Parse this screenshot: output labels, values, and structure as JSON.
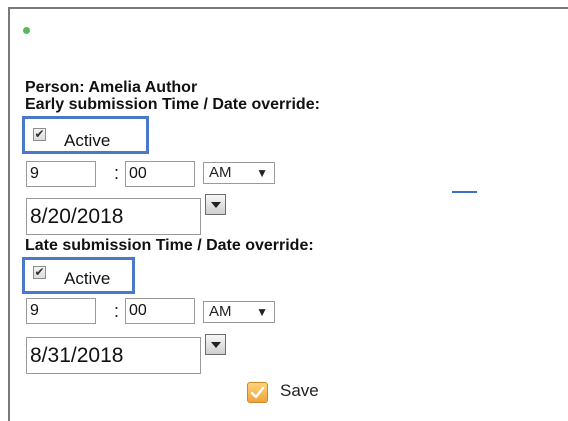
{
  "person": {
    "label": "Person: Amelia Author"
  },
  "early": {
    "heading": "Early submission Time / Date override:",
    "active_label": "Active",
    "active_checked": true,
    "hour": "9",
    "minute": "00",
    "ampm": "AM",
    "date": "8/20/2018"
  },
  "late": {
    "heading": "Late submission Time / Date override:",
    "active_label": "Active",
    "active_checked": true,
    "hour": "9",
    "minute": "00",
    "ampm": "AM",
    "date": "8/31/2018"
  },
  "colon": ":",
  "dropdown_arrow": "▼",
  "check_mark": "✔",
  "save": {
    "label": "Save"
  },
  "colors": {
    "highlight": "#4a79c9",
    "status_dot": "#5cb85c",
    "save_icon": "#f0a43a"
  }
}
